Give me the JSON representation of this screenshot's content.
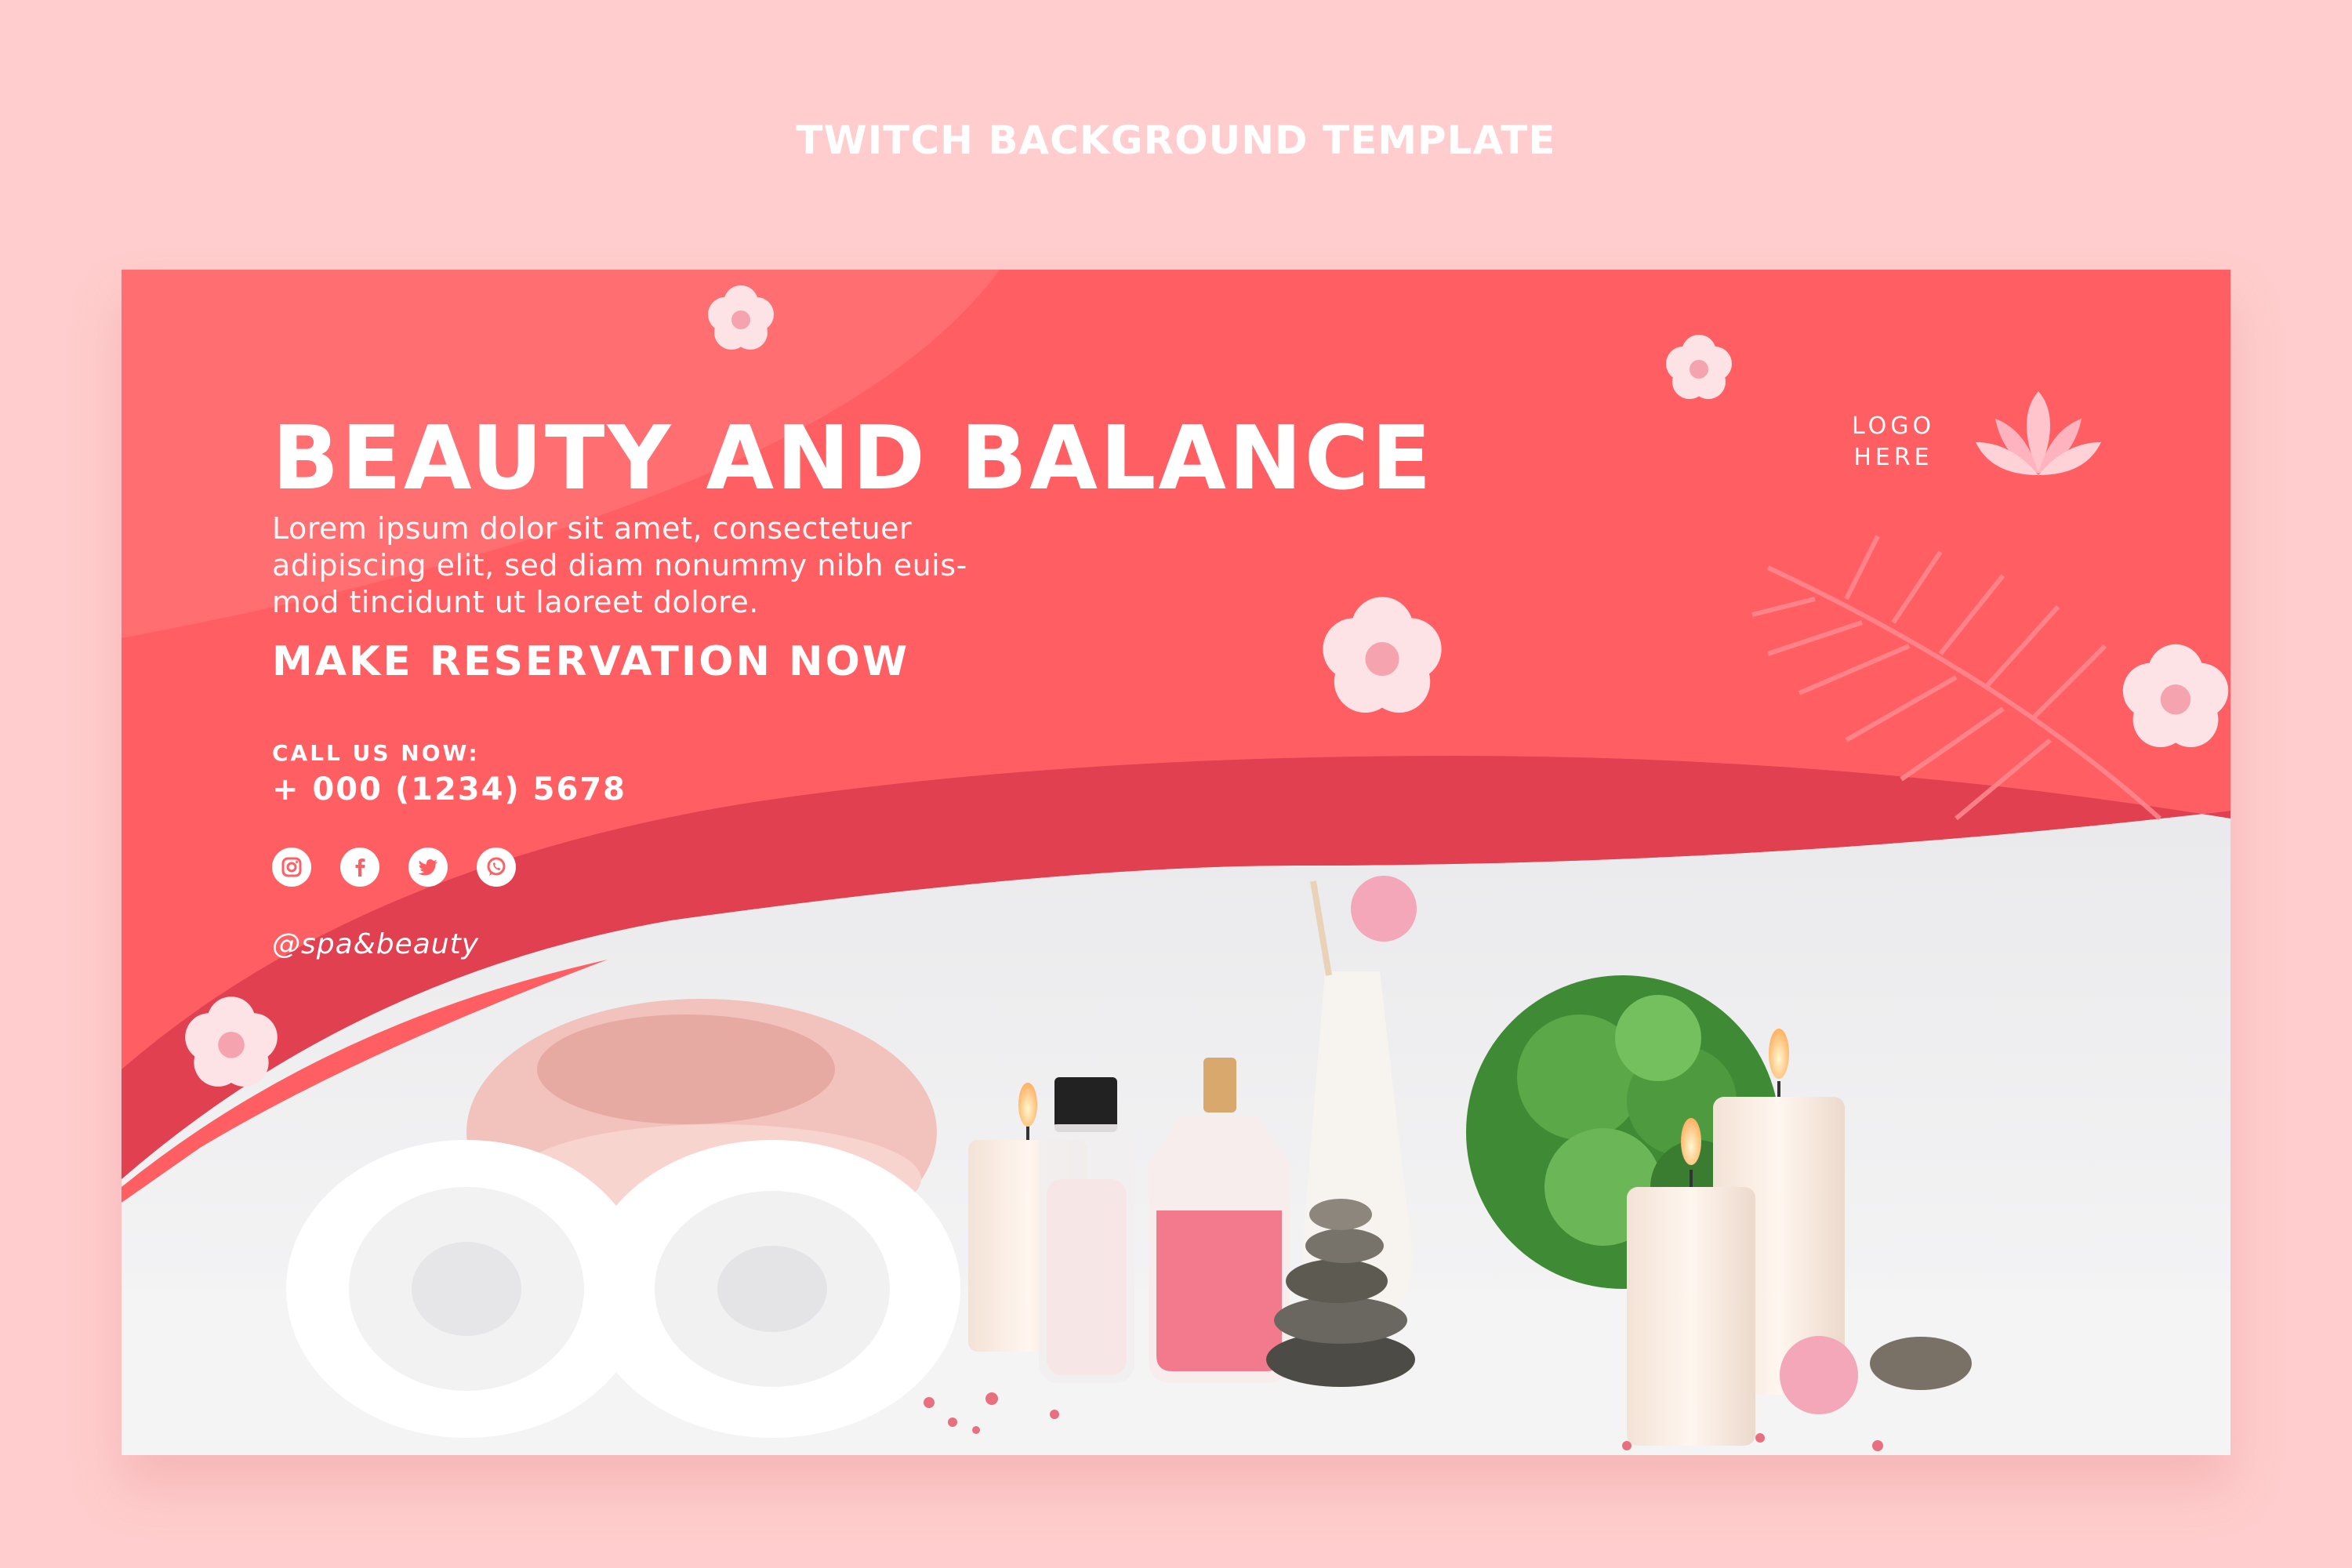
{
  "page_heading": "TWITCH BACKGROUND TEMPLATE",
  "banner": {
    "title": "BEAUTY AND BALANCE",
    "body_lines": [
      "Lorem ipsum dolor sit amet, consectetuer",
      "adipiscing elit, sed diam nonummy nibh euis-",
      "mod tincidunt ut laoreet dolore."
    ],
    "cta": "MAKE RESERVATION NOW",
    "call_label": "CALL US NOW:",
    "phone": "+ 000 (1234) 5678",
    "social_icons": [
      "instagram-icon",
      "facebook-icon",
      "twitter-icon",
      "whatsapp-icon"
    ],
    "handle": "@spa&beauty",
    "logo_line1": "LOGO",
    "logo_line2": "HERE"
  },
  "colors": {
    "page_background": "#ffcdcd",
    "banner_red": "#ff5f63",
    "wave_dark": "#e0404f",
    "text_white": "#ffffff",
    "flower_pink": "#ffc4cc"
  }
}
